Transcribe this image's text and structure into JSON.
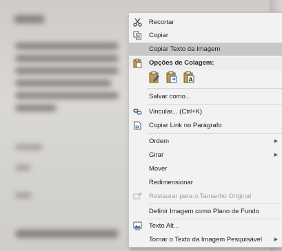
{
  "menu": {
    "items": [
      {
        "label": "Recortar",
        "icon": "scissors-icon"
      },
      {
        "label": "Copiar",
        "icon": "copy-icon"
      },
      {
        "label": "Copiar Texto da Imagem",
        "icon": ""
      },
      {
        "label": "Opções de Colagem:",
        "icon": "clipboard-icon"
      },
      {
        "label": "Salvar como...",
        "icon": ""
      },
      {
        "label": "Vincular... (Ctrl+K)",
        "icon": "link-icon"
      },
      {
        "label": "Copiar Link no Parágrafo",
        "icon": "document-link-icon"
      },
      {
        "label": "Ordem",
        "icon": ""
      },
      {
        "label": "Girar",
        "icon": ""
      },
      {
        "label": "Mover",
        "icon": ""
      },
      {
        "label": "Redimensionar",
        "icon": ""
      },
      {
        "label": "Restaurar para o Tamanho Original",
        "icon": "restore-size-icon"
      },
      {
        "label": "Definir Imagem como Plano de Fundo",
        "icon": ""
      },
      {
        "label": "Texto Alt...",
        "icon": "alt-text-icon"
      },
      {
        "label": "Tornar o Texto da Imagem Pesquisável",
        "icon": ""
      }
    ],
    "paste_options": [
      "paste-keep-formatting-icon",
      "paste-picture-icon",
      "paste-text-only-icon"
    ]
  }
}
